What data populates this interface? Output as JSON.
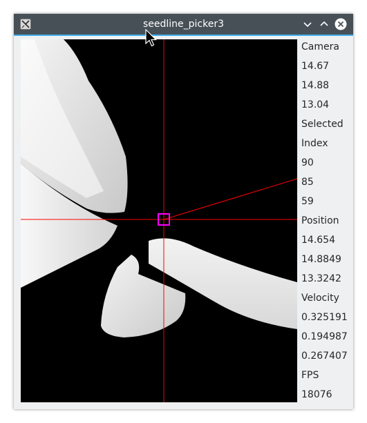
{
  "window": {
    "title": "seedline_picker3"
  },
  "titlebar_buttons": [
    "minimize",
    "maximize",
    "close"
  ],
  "icons": {
    "app": "app-icon",
    "minimize": "chevron-down-icon",
    "maximize": "chevron-up-icon",
    "close": "close-icon",
    "cursor": "mouse-pointer-icon"
  },
  "colors": {
    "titlebar": "#475057",
    "titlebar_accent": "#3daee9",
    "panel_bg": "#eff0f1",
    "viewport_bg": "#000000",
    "crosshair": "#ff0000",
    "selection_box": "#ff00ff"
  },
  "panel": {
    "camera_label": "Camera",
    "camera": [
      "14.67",
      "14.88",
      "13.04"
    ],
    "selected_label": "Selected",
    "index_label": "Index",
    "index": [
      "90",
      "85",
      "59"
    ],
    "position_label": "Position",
    "position": [
      "14.654",
      "14.8849",
      "13.3242"
    ],
    "velocity_label": "Velocity",
    "velocity": [
      "0.325191",
      "0.194987",
      "0.267407"
    ],
    "fps_label": "FPS",
    "fps": "18076"
  }
}
